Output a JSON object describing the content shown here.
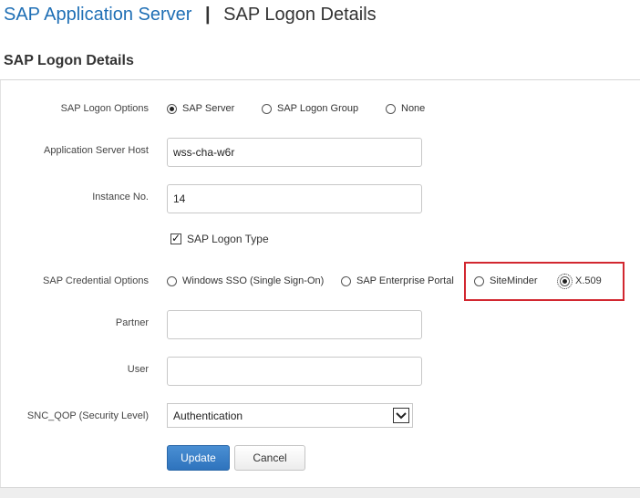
{
  "header": {
    "app_name": "SAP Application Server",
    "separator": "|",
    "page_name": "SAP Logon Details"
  },
  "section": {
    "title": "SAP Logon Details"
  },
  "form": {
    "logon_options": {
      "label": "SAP Logon Options",
      "options": [
        "SAP Server",
        "SAP Logon Group",
        "None"
      ],
      "selected": "SAP Server"
    },
    "app_server_host": {
      "label": "Application Server Host",
      "value": "wss-cha-w6r"
    },
    "instance_no": {
      "label": "Instance No.",
      "value": "14"
    },
    "logon_type": {
      "label": "SAP Logon Type",
      "checked": true
    },
    "credential_options": {
      "label": "SAP Credential Options",
      "options": [
        "Windows SSO (Single Sign-On)",
        "SAP Enterprise Portal",
        "SiteMinder",
        "X.509"
      ],
      "selected": "X.509"
    },
    "partner": {
      "label": "Partner",
      "value": ""
    },
    "user": {
      "label": "User",
      "value": ""
    },
    "snc_qop": {
      "label": "SNC_QOP (Security Level)",
      "value": "Authentication"
    }
  },
  "buttons": {
    "update": "Update",
    "cancel": "Cancel"
  },
  "colors": {
    "accent": "#1f6fb5",
    "highlight": "#d22730",
    "primary_button": "#2e73bd"
  }
}
